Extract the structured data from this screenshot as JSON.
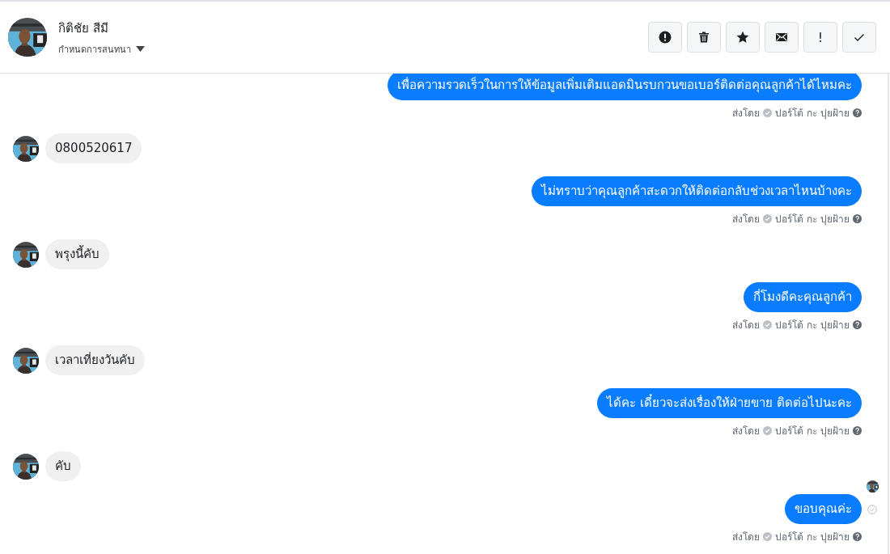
{
  "header": {
    "contact_name": "กิติชัย สีมี",
    "assign_label": "กำหนดการสนทนา",
    "actions": [
      {
        "kind": "alert"
      },
      {
        "kind": "trash"
      },
      {
        "kind": "star"
      },
      {
        "kind": "mail"
      },
      {
        "kind": "text",
        "label": "!"
      },
      {
        "kind": "check"
      }
    ]
  },
  "messages": [
    {
      "kind": "outgoing",
      "text": "เพื่อความรวดเร็วในการให้ข้อมูลเพิ่มเติมแอดมินรบกวนขอเบอร์ติดต่อคุณลูกค้าได้ไหมคะ",
      "sent_by_label": "ส่งโดย",
      "sender": "ปอร์โต้ กะ ปุยฝ้าย",
      "seen": false
    },
    {
      "kind": "incoming",
      "text": "0800520617"
    },
    {
      "kind": "outgoing",
      "text": "ไม่ทราบว่าคุณลูกค้าสะดวกให้ติดต่อกลับช่วงเวลาไหนบ้างคะ",
      "sent_by_label": "ส่งโดย",
      "sender": "ปอร์โต้ กะ ปุยฝ้าย",
      "seen": false
    },
    {
      "kind": "incoming",
      "text": "พรุงนี้คับ"
    },
    {
      "kind": "outgoing",
      "text": "กี่โมงดีคะคุณลูกค้า",
      "sent_by_label": "ส่งโดย",
      "sender": "ปอร์โต้ กะ ปุยฝ้าย",
      "seen": false
    },
    {
      "kind": "incoming",
      "text": "เวลาเที่ยงวันคับ"
    },
    {
      "kind": "outgoing",
      "text": "ได้คะ เดี๋ยวจะส่งเรื่องให้ฝ่ายขาย ติดต่อไปนะคะ",
      "sent_by_label": "ส่งโดย",
      "sender": "ปอร์โต้ กะ ปุยฝ้าย",
      "seen": false
    },
    {
      "kind": "incoming",
      "text": "คับ"
    },
    {
      "kind": "outgoing",
      "text": "ขอบคุณค่ะ",
      "sent_by_label": "ส่งโดย",
      "sender": "ปอร์โต้ กะ ปุยฝ้าย",
      "seen": true
    }
  ]
}
